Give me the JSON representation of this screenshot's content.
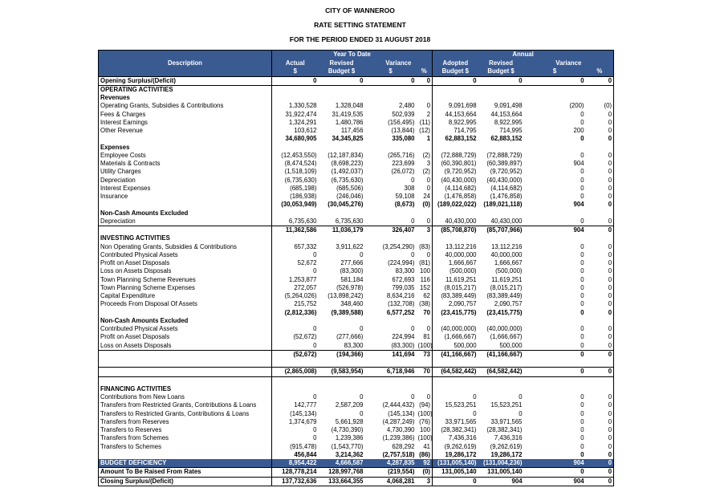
{
  "report": {
    "org": "CITY OF WANNEROO",
    "name": "RATE SETTING STATEMENT",
    "period": "FOR THE PERIOD ENDED 31 AUGUST 2018"
  },
  "headers": {
    "description": "Description",
    "ytd": "Year To Date",
    "annual": "Annual",
    "actual": "Actual",
    "revised1": "Revised",
    "budget1": "Budget",
    "variance": "Variance",
    "adopted": "Adopted",
    "budget2": "Budget",
    "revised2": "Revised",
    "budget3": "Budget",
    "variance2": "Variance",
    "dollar": "$",
    "pct": "%"
  },
  "rows": [
    {
      "style": "boxed bold",
      "d": "Opening Surplus/(Deficit)",
      "v": [
        "0",
        "0",
        "0",
        "0",
        "0",
        "0",
        "0",
        "0"
      ]
    },
    {
      "style": "bold",
      "d": "OPERATING ACTIVITIES",
      "v": [
        "",
        "",
        "",
        "",
        "",
        "",
        "",
        ""
      ]
    },
    {
      "style": "bold",
      "d": "Revenues",
      "v": [
        "",
        "",
        "",
        "",
        "",
        "",
        "",
        ""
      ]
    },
    {
      "style": "",
      "d": "Operating Grants, Subsidies & Contributions",
      "v": [
        "1,330,528",
        "1,328,048",
        "2,480",
        "0",
        "9,091,698",
        "9,091,498",
        "(200)",
        "(0)"
      ]
    },
    {
      "style": "",
      "d": "Fees & Charges",
      "v": [
        "31,922,474",
        "31,419,535",
        "502,939",
        "2",
        "44,153,664",
        "44,153,664",
        "0",
        "0"
      ]
    },
    {
      "style": "",
      "d": "Interest Earnings",
      "v": [
        "1,324,291",
        "1,480,786",
        "(156,495)",
        "(11)",
        "8,922,995",
        "8,922,995",
        "0",
        "0"
      ]
    },
    {
      "style": "",
      "d": "Other Revenue",
      "v": [
        "103,612",
        "117,456",
        "(13,844)",
        "(12)",
        "714,795",
        "714,995",
        "200",
        "0"
      ]
    },
    {
      "style": "tot",
      "d": "",
      "v": [
        "34,680,905",
        "34,345,825",
        "335,080",
        "1",
        "62,883,152",
        "62,883,152",
        "0",
        "0"
      ]
    },
    {
      "style": "bold",
      "d": "Expenses",
      "v": [
        "",
        "",
        "",
        "",
        "",
        "",
        "",
        ""
      ]
    },
    {
      "style": "",
      "d": "Employee Costs",
      "v": [
        "(12,453,550)",
        "(12,187,834)",
        "(265,716)",
        "(2)",
        "(72,888,729)",
        "(72,888,729)",
        "0",
        "0"
      ]
    },
    {
      "style": "",
      "d": "Materials & Contracts",
      "v": [
        "(8,474,524)",
        "(8,698,223)",
        "223,699",
        "3",
        "(60,390,801)",
        "(60,389,897)",
        "904",
        "0"
      ]
    },
    {
      "style": "",
      "d": "Utility Charges",
      "v": [
        "(1,518,109)",
        "(1,492,037)",
        "(26,072)",
        "(2)",
        "(9,720,952)",
        "(9,720,952)",
        "0",
        "0"
      ]
    },
    {
      "style": "",
      "d": "Depreciation",
      "v": [
        "(6,735,630)",
        "(6,735,630)",
        "0",
        "0",
        "(40,430,000)",
        "(40,430,000)",
        "0",
        "0"
      ]
    },
    {
      "style": "",
      "d": "Interest Expenses",
      "v": [
        "(685,198)",
        "(685,506)",
        "308",
        "0",
        "(4,114,682)",
        "(4,114,682)",
        "0",
        "0"
      ]
    },
    {
      "style": "",
      "d": "Insurance",
      "v": [
        "(186,938)",
        "(246,046)",
        "59,108",
        "24",
        "(1,476,858)",
        "(1,476,858)",
        "0",
        "0"
      ]
    },
    {
      "style": "tot",
      "d": "",
      "v": [
        "(30,053,949)",
        "(30,045,276)",
        "(8,673)",
        "(0)",
        "(189,022,022)",
        "(189,021,118)",
        "904",
        "0"
      ]
    },
    {
      "style": "bold",
      "d": "Non-Cash Amounts Excluded",
      "v": [
        "",
        "",
        "",
        "",
        "",
        "",
        "",
        ""
      ]
    },
    {
      "style": "",
      "d": "Depreciation",
      "v": [
        "6,735,630",
        "6,735,630",
        "0",
        "0",
        "40,430,000",
        "40,430,000",
        "0",
        "0"
      ]
    },
    {
      "style": "tot topline",
      "d": "",
      "v": [
        "11,362,586",
        "11,036,179",
        "326,407",
        "3",
        "(85,708,870)",
        "(85,707,966)",
        "904",
        "0"
      ]
    },
    {
      "style": "bold",
      "d": "INVESTING ACTIVITIES",
      "v": [
        "",
        "",
        "",
        "",
        "",
        "",
        "",
        ""
      ]
    },
    {
      "style": "",
      "d": "Non Operating Grants, Subsidies & Contributions",
      "v": [
        "657,332",
        "3,911,622",
        "(3,254,290)",
        "(83)",
        "13,112,216",
        "13,112,216",
        "0",
        "0"
      ]
    },
    {
      "style": "",
      "d": "Contributed Physical Assets",
      "v": [
        "0",
        "0",
        "0",
        "0",
        "40,000,000",
        "40,000,000",
        "0",
        "0"
      ]
    },
    {
      "style": "",
      "d": "Profit on Asset Disposals",
      "v": [
        "52,672",
        "277,666",
        "(224,994)",
        "(81)",
        "1,666,667",
        "1,666,667",
        "0",
        "0"
      ]
    },
    {
      "style": "",
      "d": "Loss on Assets Disposals",
      "v": [
        "0",
        "(83,300)",
        "83,300",
        "100",
        "(500,000)",
        "(500,000)",
        "0",
        "0"
      ]
    },
    {
      "style": "",
      "d": "Town Planning Scheme Revenues",
      "v": [
        "1,253,877",
        "581,184",
        "672,693",
        "116",
        "11,619,251",
        "11,619,251",
        "0",
        "0"
      ]
    },
    {
      "style": "",
      "d": "Town Planning Scheme Expenses",
      "v": [
        "272,057",
        "(526,978)",
        "799,035",
        "152",
        "(8,015,217)",
        "(8,015,217)",
        "0",
        "0"
      ]
    },
    {
      "style": "",
      "d": "Capital Expenditure",
      "v": [
        "(5,264,026)",
        "(13,898,242)",
        "8,634,216",
        "62",
        "(83,389,449)",
        "(83,389,449)",
        "0",
        "0"
      ]
    },
    {
      "style": "",
      "d": "Proceeds From Disposal Of Assets",
      "v": [
        "215,752",
        "348,460",
        "(132,708)",
        "(38)",
        "2,090,757",
        "2,090,757",
        "0",
        "0"
      ]
    },
    {
      "style": "tot",
      "d": "",
      "v": [
        "(2,812,336)",
        "(9,389,588)",
        "6,577,252",
        "70",
        "(23,415,775)",
        "(23,415,775)",
        "0",
        "0"
      ]
    },
    {
      "style": "bold",
      "d": "Non-Cash Amounts Excluded",
      "v": [
        "",
        "",
        "",
        "",
        "",
        "",
        "",
        ""
      ]
    },
    {
      "style": "",
      "d": "Contributed Physical Assets",
      "v": [
        "0",
        "0",
        "0",
        "0",
        "(40,000,000)",
        "(40,000,000)",
        "0",
        "0"
      ]
    },
    {
      "style": "",
      "d": "Profit on Asset Disposals",
      "v": [
        "(52,672)",
        "(277,666)",
        "224,994",
        "81",
        "(1,666,667)",
        "(1,666,667)",
        "0",
        "0"
      ]
    },
    {
      "style": "",
      "d": "Loss on Assets Disposals",
      "v": [
        "0",
        "83,300",
        "(83,300)",
        "(100)",
        "500,000",
        "500,000",
        "0",
        "0"
      ]
    },
    {
      "style": "tot topline",
      "d": "",
      "v": [
        "(52,672)",
        "(194,366)",
        "141,694",
        "73",
        "(41,166,667)",
        "(41,166,667)",
        "0",
        "0"
      ]
    },
    {
      "style": "blank",
      "d": "",
      "v": [
        "",
        "",
        "",
        "",
        "",
        "",
        "",
        ""
      ]
    },
    {
      "style": "tot boxed",
      "d": "",
      "v": [
        "(2,865,008)",
        "(9,583,954)",
        "6,718,946",
        "70",
        "(64,582,442)",
        "(64,582,442)",
        "0",
        "0"
      ]
    },
    {
      "style": "blank",
      "d": "",
      "v": [
        "",
        "",
        "",
        "",
        "",
        "",
        "",
        ""
      ]
    },
    {
      "style": "bold",
      "d": "FINANCING ACTIVITIES",
      "v": [
        "",
        "",
        "",
        "",
        "",
        "",
        "",
        ""
      ]
    },
    {
      "style": "",
      "d": "Contributions from New Loans",
      "v": [
        "0",
        "0",
        "0",
        "0",
        "0",
        "0",
        "0",
        "0"
      ]
    },
    {
      "style": "",
      "d": "Transfers from Restricted Grants, Contributions & Loans",
      "v": [
        "142,777",
        "2,587,209",
        "(2,444,432)",
        "(94)",
        "15,523,251",
        "15,523,251",
        "0",
        "0"
      ]
    },
    {
      "style": "",
      "d": "Transfers to Restricted Grants, Contributions & Loans",
      "v": [
        "(145,134)",
        "0",
        "(145,134)",
        "(100)",
        "0",
        "0",
        "0",
        "0"
      ]
    },
    {
      "style": "",
      "d": "Transfers from Reserves",
      "v": [
        "1,374,679",
        "5,661,928",
        "(4,287,249)",
        "(76)",
        "33,971,565",
        "33,971,565",
        "0",
        "0"
      ]
    },
    {
      "style": "",
      "d": "Transfers to Reserves",
      "v": [
        "0",
        "(4,730,390)",
        "4,730,390",
        "100",
        "(28,382,341)",
        "(28,382,341)",
        "0",
        "0"
      ]
    },
    {
      "style": "",
      "d": "Transfers from Schemes",
      "v": [
        "0",
        "1,239,386",
        "(1,239,386)",
        "(100)",
        "7,436,316",
        "7,436,316",
        "0",
        "0"
      ]
    },
    {
      "style": "",
      "d": "Transfers to Schemes",
      "v": [
        "(915,478)",
        "(1,543,770)",
        "628,292",
        "41",
        "(9,262,619)",
        "(9,262,619)",
        "0",
        "0"
      ]
    },
    {
      "style": "tot",
      "d": "",
      "v": [
        "456,844",
        "3,214,362",
        "(2,757,518)",
        "(86)",
        "19,286,172",
        "19,286,172",
        "0",
        "0"
      ]
    },
    {
      "style": "hl",
      "d": "BUDGET DEFICIENCY",
      "v": [
        "8,954,422",
        "4,666,587",
        "4,287,835",
        "92",
        "(131,005,140)",
        "(131,004,236)",
        "904",
        "0"
      ]
    },
    {
      "style": "boxed bold",
      "d": "Amount To Be Raised From Rates",
      "v": [
        "128,778,214",
        "128,997,768",
        "(219,554)",
        "(0)",
        "131,005,140",
        "131,005,140",
        "0",
        "0"
      ]
    },
    {
      "style": "boxed bold",
      "d": "Closing Surplus/(Deficit)",
      "v": [
        "137,732,636",
        "133,664,355",
        "4,068,281",
        "3",
        "0",
        "904",
        "904",
        "0"
      ]
    }
  ]
}
